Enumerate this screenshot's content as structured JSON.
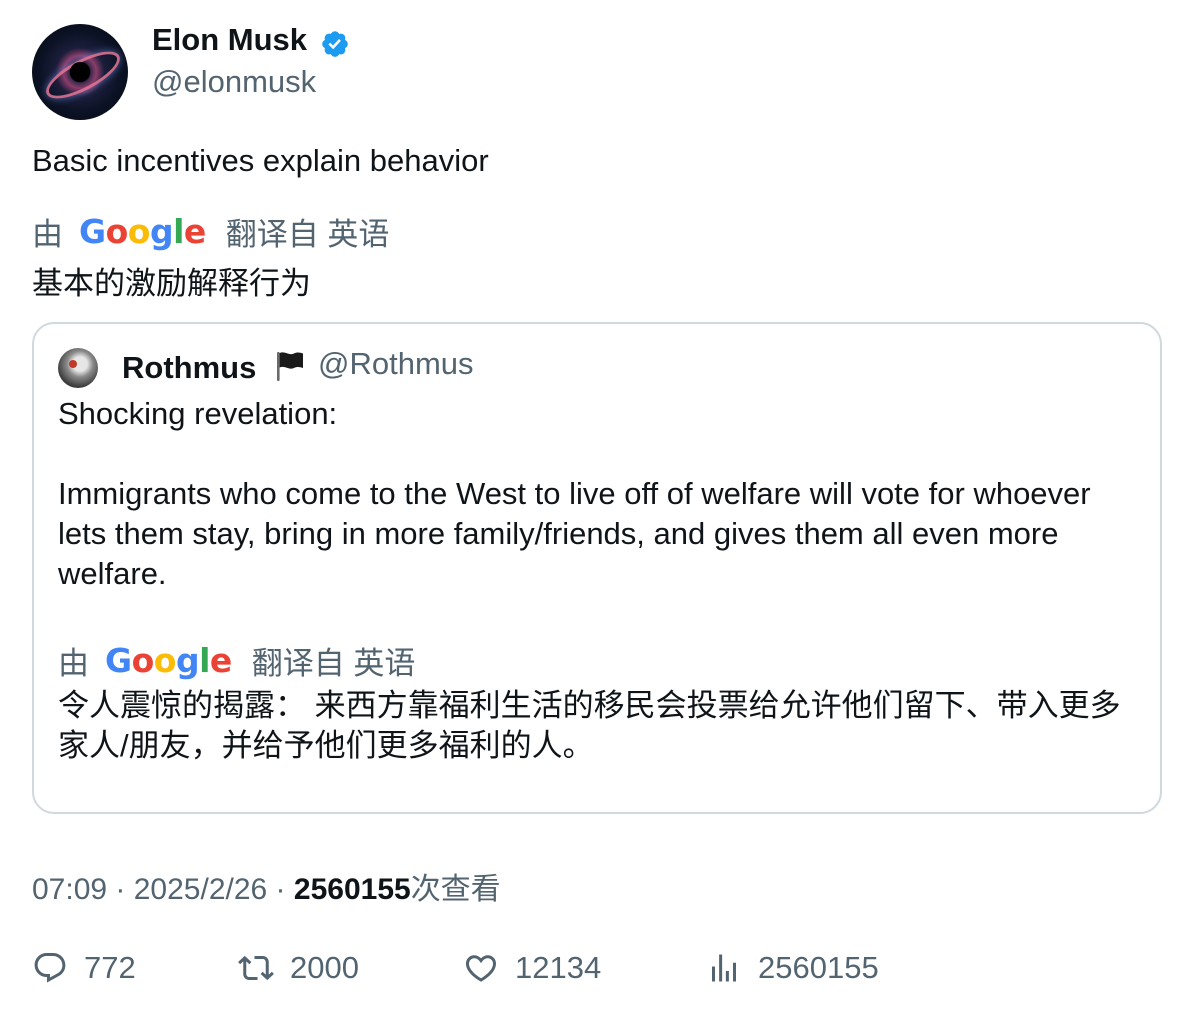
{
  "author": {
    "name": "Elon Musk",
    "handle": "@elonmusk",
    "verified_icon": "verified-badge-icon",
    "verified_color": "#1d9bf0"
  },
  "tweet": {
    "text": "Basic incentives explain behavior",
    "translation_by": "由",
    "translation_from": "翻译自 英语",
    "translated_text": "基本的激励解释行为"
  },
  "quote": {
    "name": "Rothmus",
    "flag_icon": "black-flag-icon",
    "handle": "@Rothmus",
    "line1": "Shocking revelation:",
    "line2": "Immigrants who come to the West to live off of welfare will vote for whoever lets them stay, bring in more family/friends, and gives them all even more welfare.",
    "translation_by": "由",
    "translation_from": "翻译自 英语",
    "translated_text": "令人震惊的揭露： 来西方靠福利生活的移民会投票给允许他们留下、带入更多家人/朋友，并给予他们更多福利的人。"
  },
  "google_logo": {
    "G": "G",
    "o1": "o",
    "o2": "o",
    "g": "g",
    "l": "l",
    "e": "e"
  },
  "meta": {
    "time": "07:09",
    "sep1": " · ",
    "date": "2025/2/26",
    "sep2": " · ",
    "views": "2560155",
    "views_suffix": "次查看"
  },
  "actions": {
    "replies": "772",
    "retweets": "2000",
    "likes": "12134",
    "views": "2560155"
  },
  "colors": {
    "text_primary": "#0f1419",
    "text_secondary": "#536471",
    "border": "#cfd9de"
  }
}
